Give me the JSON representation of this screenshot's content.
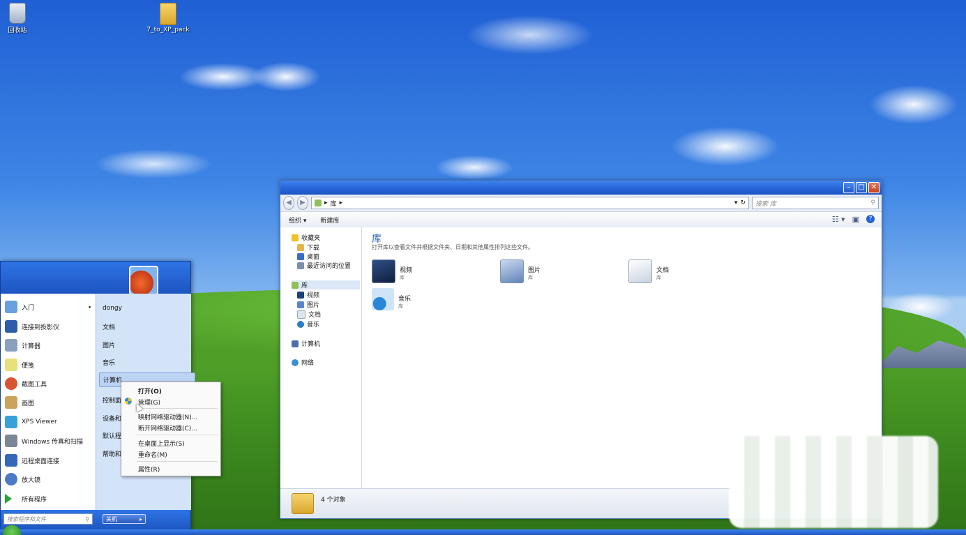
{
  "desktop": {
    "icons": [
      {
        "label": "回收站",
        "icon": "recycle-bin-icon"
      },
      {
        "label": "7_to_XP_pack",
        "icon": "folder-icon"
      }
    ]
  },
  "explorer": {
    "address": {
      "breadcrumb": "库",
      "sep": "▸",
      "dropdown": "▾",
      "refresh": "↻"
    },
    "search_placeholder": "搜索 库",
    "toolbar": {
      "organize": "组织 ▾",
      "new_library": "新建库"
    },
    "nav": {
      "favorites": "收藏夹",
      "downloads": "下载",
      "desktop": "桌面",
      "recent": "最近访问的位置",
      "libraries": "库",
      "videos": "视频",
      "pictures": "图片",
      "documents": "文档",
      "music": "音乐",
      "computer": "计算机",
      "network": "网络"
    },
    "content": {
      "title": "库",
      "description": "打开库以查看文件并根据文件夹、日期和其他属性排列这些文件。",
      "items": [
        {
          "name": "视频",
          "sub": "库"
        },
        {
          "name": "图片",
          "sub": "库"
        },
        {
          "name": "文档",
          "sub": "库"
        },
        {
          "name": "音乐",
          "sub": "库"
        }
      ]
    },
    "status": "4 个对象"
  },
  "startmenu": {
    "left": [
      {
        "label": "入门",
        "arrow": "▸"
      },
      {
        "label": "连接到投影仪"
      },
      {
        "label": "计算器"
      },
      {
        "label": "便笺"
      },
      {
        "label": "截图工具"
      },
      {
        "label": "画图"
      },
      {
        "label": "XPS Viewer"
      },
      {
        "label": "Windows 传真和扫描"
      },
      {
        "label": "远程桌面连接"
      },
      {
        "label": "放大镜"
      }
    ],
    "all_programs": "所有程序",
    "right": [
      {
        "label": "dongy"
      },
      {
        "label": "文档"
      },
      {
        "label": "图片"
      },
      {
        "label": "音乐"
      },
      {
        "label": "计算机"
      },
      {
        "label": "控制面"
      },
      {
        "label": "设备和"
      },
      {
        "label": "默认程"
      },
      {
        "label": "帮助和"
      }
    ],
    "search_placeholder": "搜索程序和文件",
    "shutdown": "关机",
    "shutdown_arrow": "▸"
  },
  "context_menu": [
    {
      "label": "打开(O)"
    },
    {
      "label": "管理(G)"
    },
    {
      "label": "映射网络驱动器(N)..."
    },
    {
      "label": "断开网络驱动器(C)..."
    },
    {
      "label": "在桌面上显示(S)"
    },
    {
      "label": "重命名(M)"
    },
    {
      "label": "属性(R)"
    }
  ],
  "colors": {
    "accent": "#2463d6",
    "title_blue": "#1e5aa8"
  }
}
